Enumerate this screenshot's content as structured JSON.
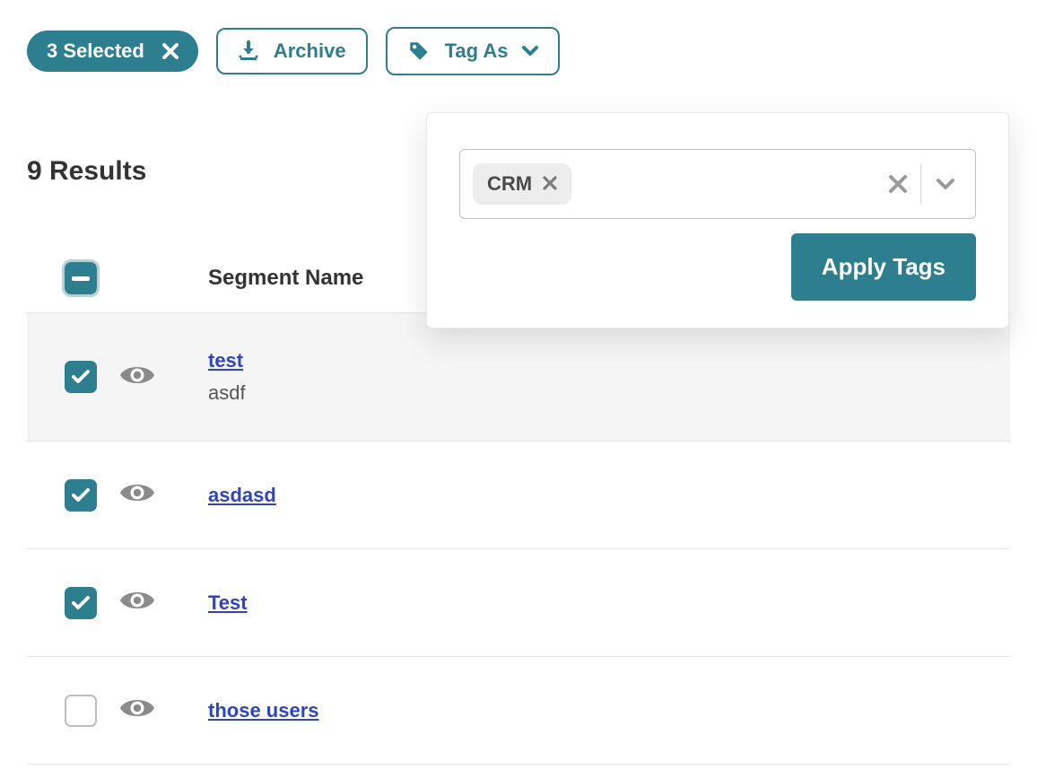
{
  "toolbar": {
    "selected_label": "3 Selected",
    "archive_label": "Archive",
    "tag_as_label": "Tag As"
  },
  "results": {
    "heading": "9 Results"
  },
  "popover": {
    "chip_label": "CRM",
    "apply_label": "Apply Tags"
  },
  "table": {
    "header": {
      "segment_name": "Segment Name"
    },
    "rows": [
      {
        "checked": true,
        "highlighted": true,
        "name": "test",
        "sub": "asdf"
      },
      {
        "checked": true,
        "highlighted": false,
        "name": "asdasd",
        "sub": ""
      },
      {
        "checked": true,
        "highlighted": false,
        "name": "Test",
        "sub": ""
      },
      {
        "checked": false,
        "highlighted": false,
        "name": "those users",
        "sub": ""
      }
    ]
  }
}
